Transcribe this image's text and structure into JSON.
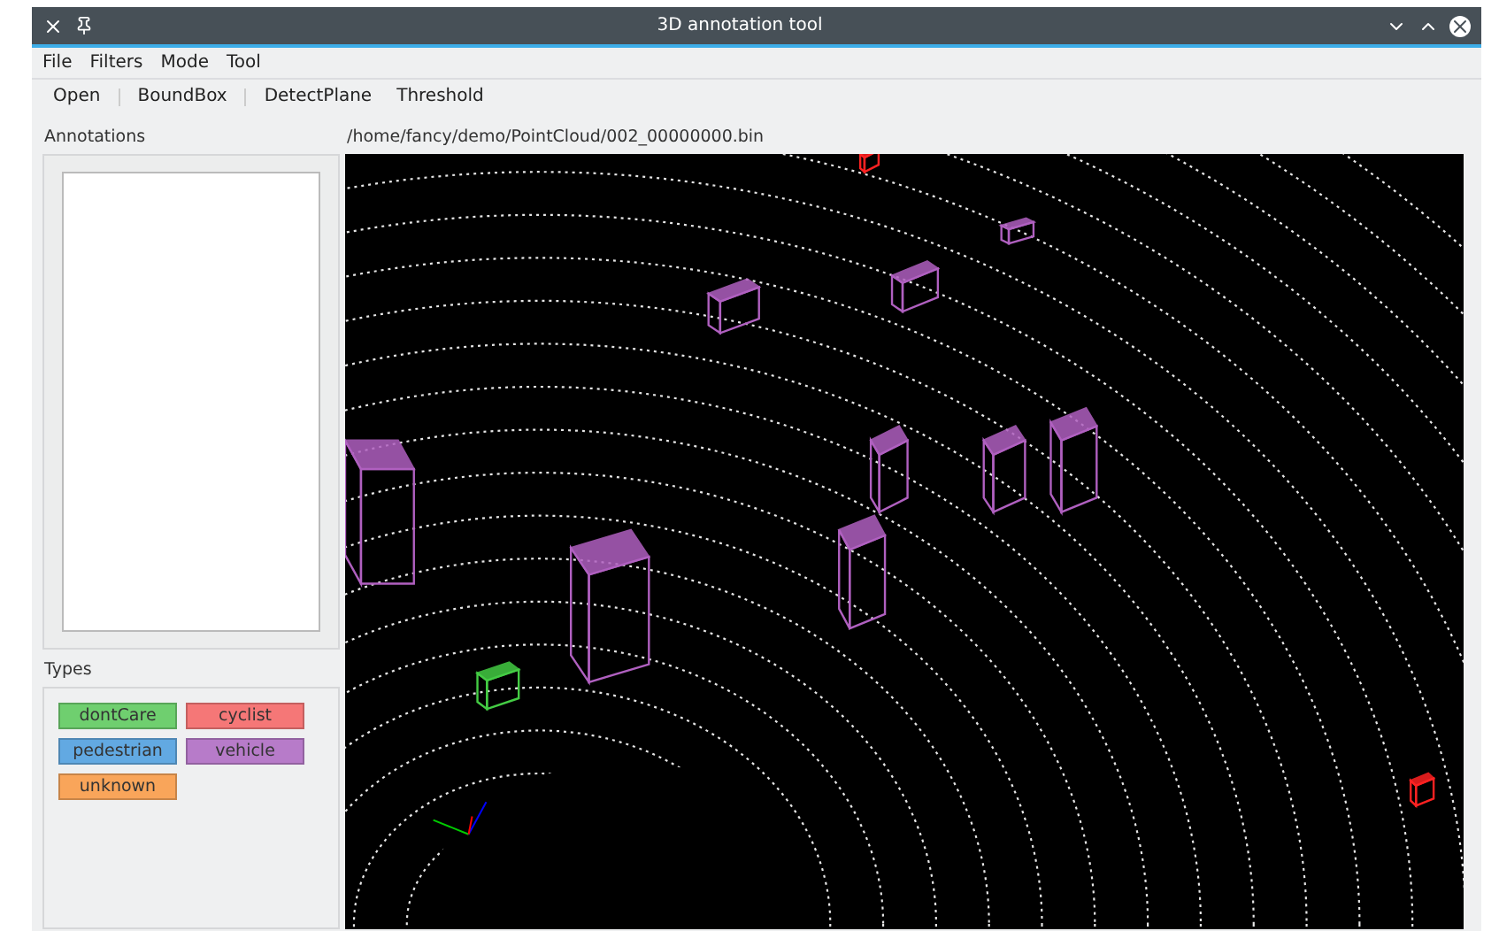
{
  "window": {
    "title": "3D annotation tool"
  },
  "menu": [
    "File",
    "Filters",
    "Mode",
    "Tool"
  ],
  "toolbar": [
    "Open",
    "BoundBox",
    "DetectPlane",
    "Threshold"
  ],
  "annotations": {
    "label": "Annotations"
  },
  "types": {
    "label": "Types",
    "items": [
      {
        "label": "dontCare",
        "color": "#6fcf6f"
      },
      {
        "label": "cyclist",
        "color": "#f57777"
      },
      {
        "label": "pedestrian",
        "color": "#62a9e2"
      },
      {
        "label": "vehicle",
        "color": "#b77bc9"
      },
      {
        "label": "unknown",
        "color": "#f9a55a"
      }
    ]
  },
  "viewer": {
    "path": "/home/fancy/demo/PointCloud/002_00000000.bin"
  }
}
